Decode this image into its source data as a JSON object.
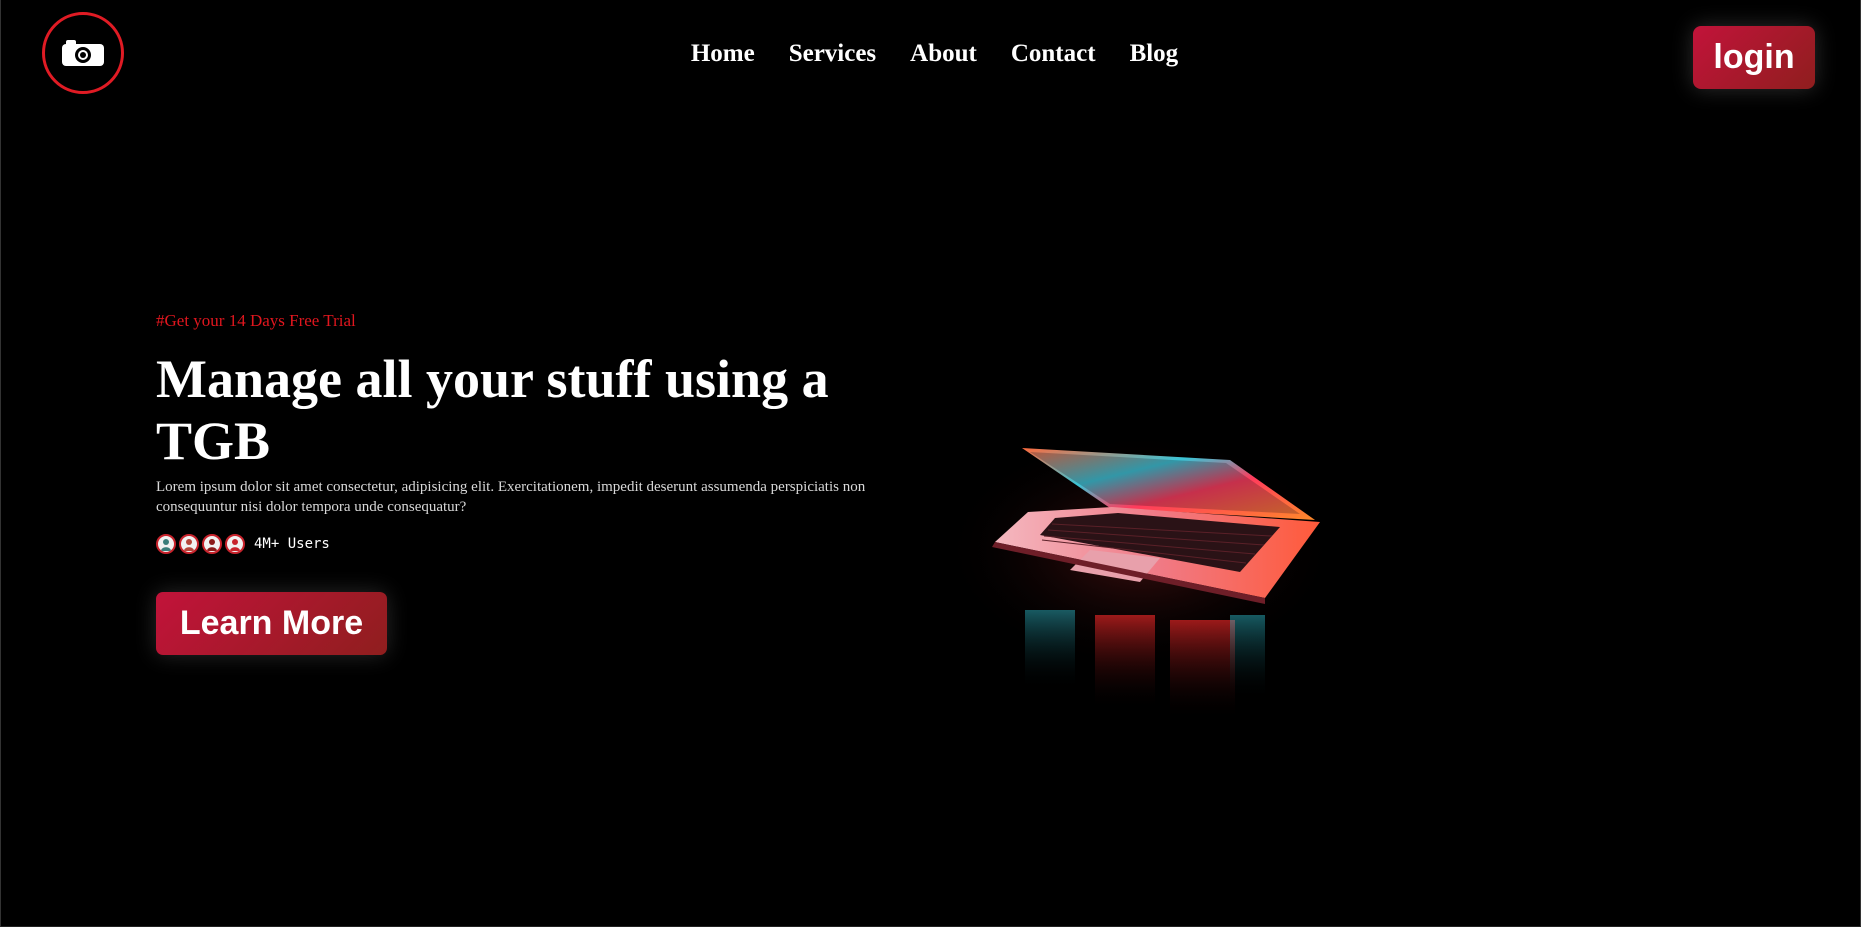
{
  "header": {
    "logo_icon": "camera-icon",
    "nav": [
      {
        "label": "Home"
      },
      {
        "label": "Services"
      },
      {
        "label": "About"
      },
      {
        "label": "Contact"
      },
      {
        "label": "Blog"
      }
    ],
    "login_label": "login"
  },
  "hero": {
    "tagline": "#Get your 14 Days Free Trial",
    "headline": "Manage all your stuff using a TGB",
    "description": "Lorem ipsum dolor sit amet consectetur, adipisicing elit. Exercitationem, impedit deserunt assumenda perspiciatis non consequuntur nisi dolor tempora unde consequatur?",
    "users_count": "4M+ Users",
    "cta_label": "Learn More",
    "image_icon": "laptop-icon"
  },
  "colors": {
    "background": "#000000",
    "accent": "#e0161e",
    "button_gradient_start": "#c2133a",
    "button_gradient_end": "#8f1e1e"
  }
}
